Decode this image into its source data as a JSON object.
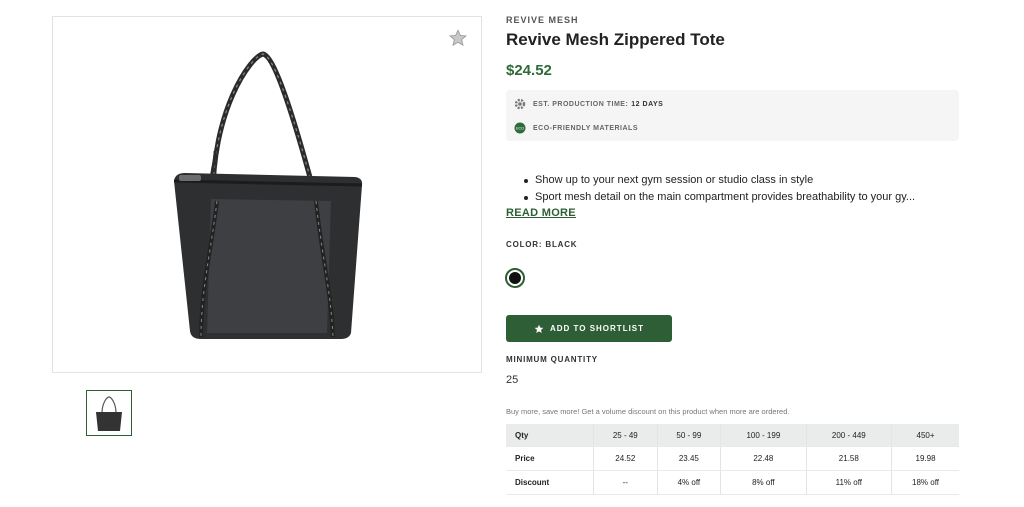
{
  "product": {
    "brand": "REVIVE MESH",
    "title": "Revive Mesh Zippered Tote",
    "price": "$24.52"
  },
  "info": {
    "production_label": "EST. PRODUCTION TIME:",
    "production_value": "12 DAYS",
    "eco_label": "ECO-FRIENDLY MATERIALS",
    "eco_badge": "ECO"
  },
  "description": {
    "bullets": [
      "Show up to your next gym session or studio class in style",
      "Sport mesh detail on the main compartment provides breathability to your gy..."
    ],
    "read_more": "READ MORE"
  },
  "color": {
    "label": "COLOR: BLACK",
    "swatch_hex": "#111111"
  },
  "actions": {
    "add_to_shortlist": "ADD TO SHORTLIST"
  },
  "minimum_quantity": {
    "label": "MINIMUM QUANTITY",
    "value": "25"
  },
  "volume": {
    "note": "Buy more, save more! Get a volume discount on this product when more are ordered.",
    "header": [
      "Qty",
      "25 - 49",
      "50 - 99",
      "100 - 199",
      "200 - 449",
      "450+"
    ],
    "price_row": [
      "Price",
      "24.52",
      "23.45",
      "22.48",
      "21.58",
      "19.98"
    ],
    "discount_row": [
      "Discount",
      "--",
      "4% off",
      "8% off",
      "11% off",
      "18% off"
    ]
  },
  "colors": {
    "accent": "#2e5e35",
    "price": "#2e6b38"
  },
  "icons": {
    "favorite": "star-icon",
    "production": "gear-icon",
    "eco": "eco-badge-icon",
    "shortlist": "star-icon"
  }
}
